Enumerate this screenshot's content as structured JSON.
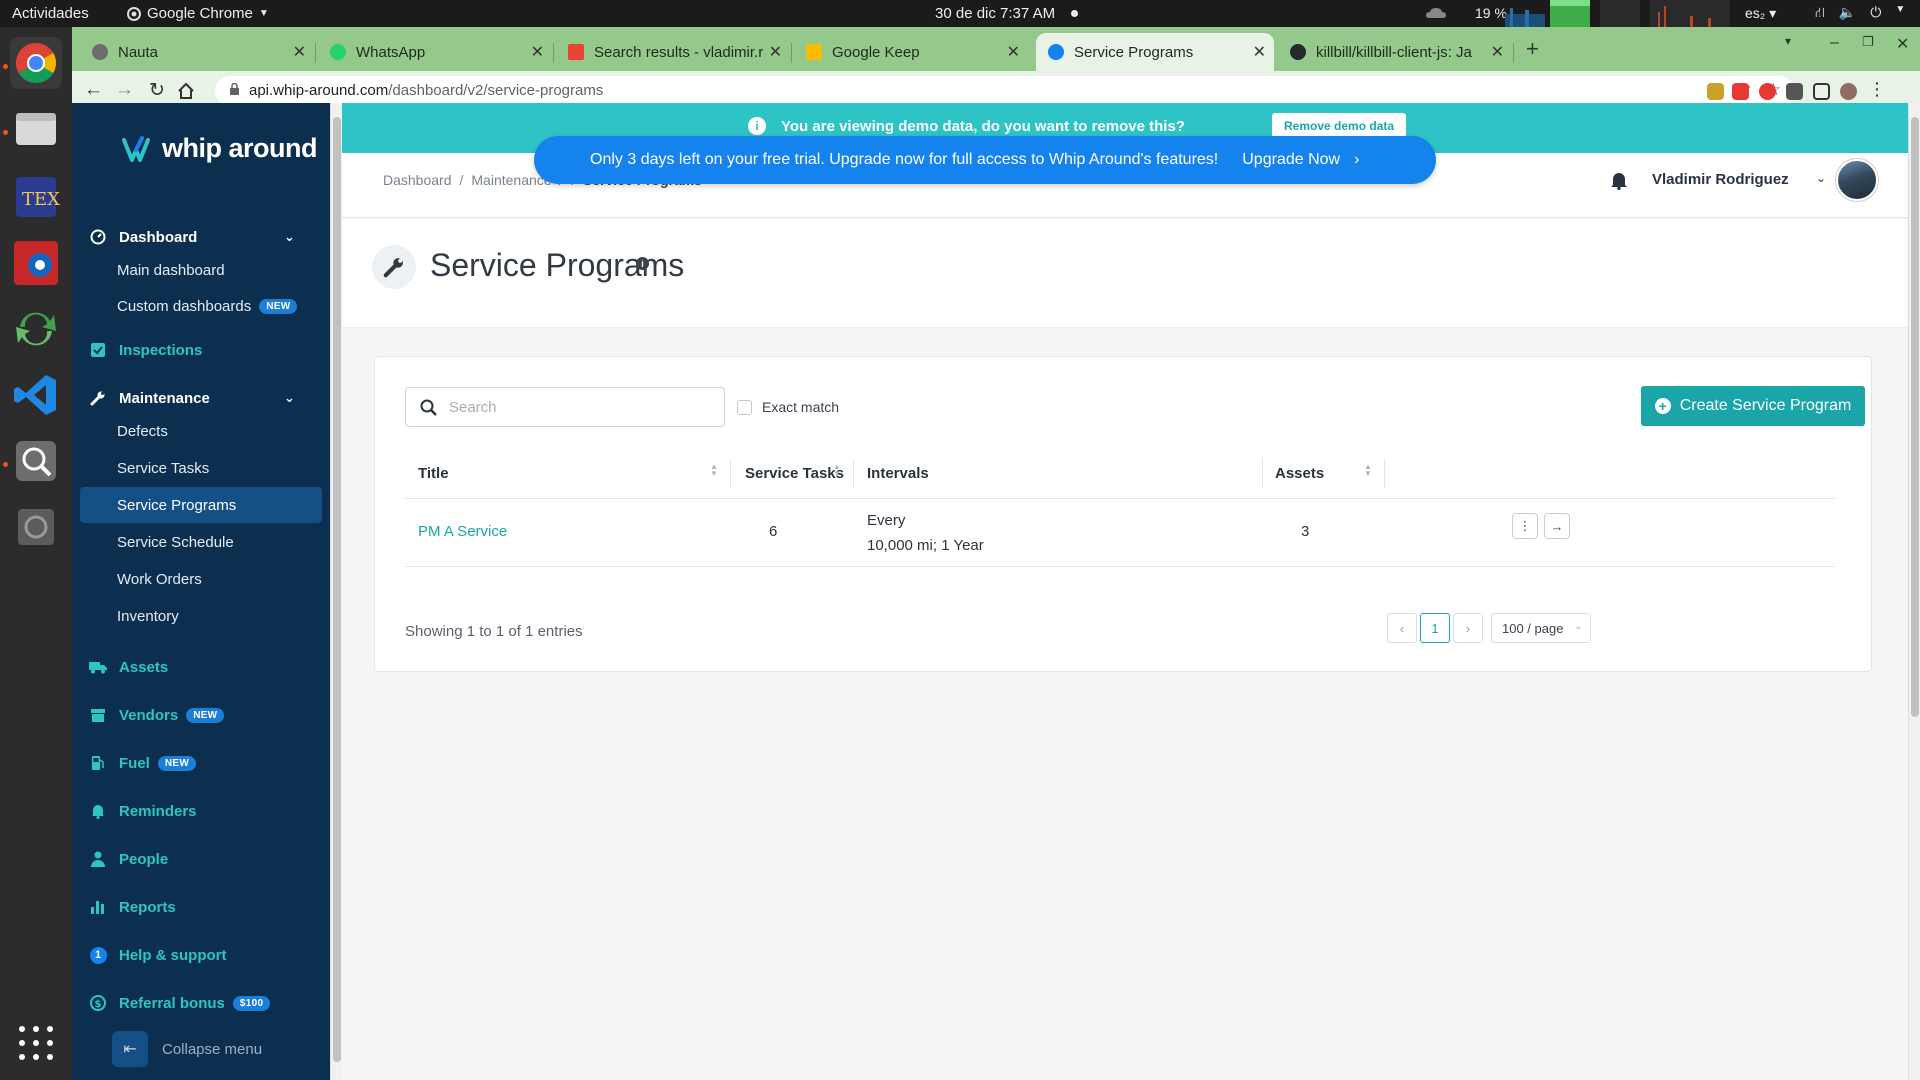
{
  "gnome": {
    "activities": "Actividades",
    "app_menu": "Google Chrome",
    "clock": "30 de dic  7:37 AM",
    "cpu": "19 %",
    "lang": "es₂"
  },
  "tabs": [
    {
      "label": "Nauta"
    },
    {
      "label": "WhatsApp"
    },
    {
      "label": "Search results - vladimir.r"
    },
    {
      "label": "Google Keep"
    },
    {
      "label": "Service Programs"
    },
    {
      "label": "killbill/killbill-client-js: Ja"
    }
  ],
  "address": {
    "host": "api.whip-around.com",
    "path": "/dashboard/v2/service-programs"
  },
  "brand": {
    "name": "whip around",
    "accent": "#2ec4c6",
    "sidebar_bg": "#0d2f4f",
    "primary_button": "#1aa6a8",
    "trial_blue": "#1583ee"
  },
  "sidebar": {
    "dashboard": "Dashboard",
    "main_dashboard": "Main dashboard",
    "custom_dashboards": "Custom dashboards",
    "new_badge": "NEW",
    "inspections": "Inspections",
    "maintenance": "Maintenance",
    "defects": "Defects",
    "service_tasks": "Service Tasks",
    "service_programs": "Service Programs",
    "service_schedule": "Service Schedule",
    "work_orders": "Work Orders",
    "inventory": "Inventory",
    "assets": "Assets",
    "vendors": "Vendors",
    "fuel": "Fuel",
    "reminders": "Reminders",
    "people": "People",
    "reports": "Reports",
    "help_support": "Help & support",
    "help_count": "1",
    "referral_bonus": "Referral bonus",
    "referral_badge": "$100",
    "collapse_menu": "Collapse menu"
  },
  "demo_banner": {
    "text": "You are viewing demo data, do you want to remove this?",
    "button": "Remove demo data"
  },
  "trial_banner": {
    "text": "Only 3 days left on your free trial. Upgrade now for full access to Whip Around's features!",
    "cta": "Upgrade Now"
  },
  "breadcrumb": {
    "home": "Dashboard",
    "section": "Maintenance",
    "current": "Service Programs"
  },
  "user": {
    "name": "Vladimir Rodriguez"
  },
  "page": {
    "title": "Service Programs"
  },
  "search": {
    "placeholder": "Search",
    "exact_match": "Exact match"
  },
  "create_button": "Create Service Program",
  "table": {
    "columns": [
      "Title",
      "Service Tasks",
      "Intervals",
      "Assets"
    ],
    "rows": [
      {
        "title": "PM A Service",
        "service_tasks": "6",
        "interval_line1": "Every",
        "interval_line2": "10,000 mi; 1 Year",
        "assets": "3"
      }
    ]
  },
  "footer": {
    "entries": "Showing 1 to 1 of 1 entries",
    "current_page": "1",
    "per_page": "100 / page"
  }
}
